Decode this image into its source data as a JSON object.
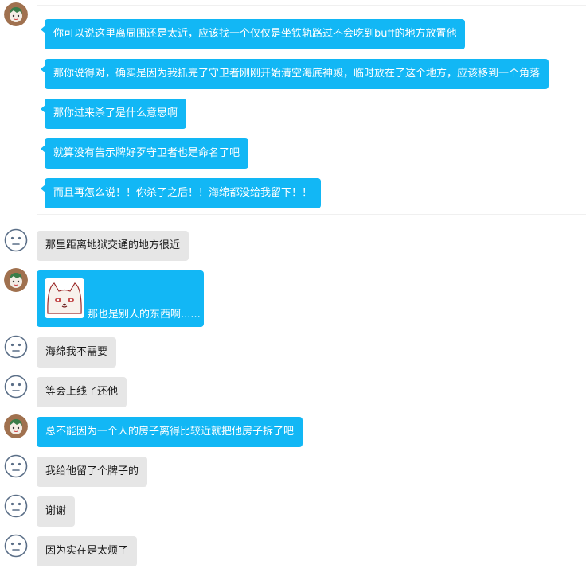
{
  "colors": {
    "outgoing_bubble": "#12b7f5",
    "incoming_bubble": "#e6e6e6",
    "outgoing_text": "#ffffff",
    "incoming_text": "#1a1a1a"
  },
  "messages": {
    "m1": "你可以说这里离周围还是太近，应该找一个仅仅是坐铁轨路过不会吃到buff的地方放置他",
    "m2": "那你说得对，确实是因为我抓完了守卫者刚刚开始清空海底神殿，临时放在了这个地方，应该移到一个角落",
    "m3": "那你过来杀了是什么意思啊",
    "m4": "就算没有告示牌好歹守卫者也是命名了吧",
    "m5": "而且再怎么说！！你杀了之后！！海绵都没给我留下！！",
    "m6": "那里距离地狱交通的地方很近",
    "m7": "那也是别人的东西啊......",
    "m8": "海绵我不需要",
    "m9": "等会上线了还他",
    "m10": "总不能因为一个人的房子离得比较近就把他房子拆了吧",
    "m11": "我给他留了个牌子的",
    "m12": "谢谢",
    "m13": "因为实在是太烦了"
  },
  "icons": {
    "self_avatar": "anime-avatar-icon",
    "other_avatar": "neutral-face-icon",
    "sticker": "white-dog-sticker"
  }
}
